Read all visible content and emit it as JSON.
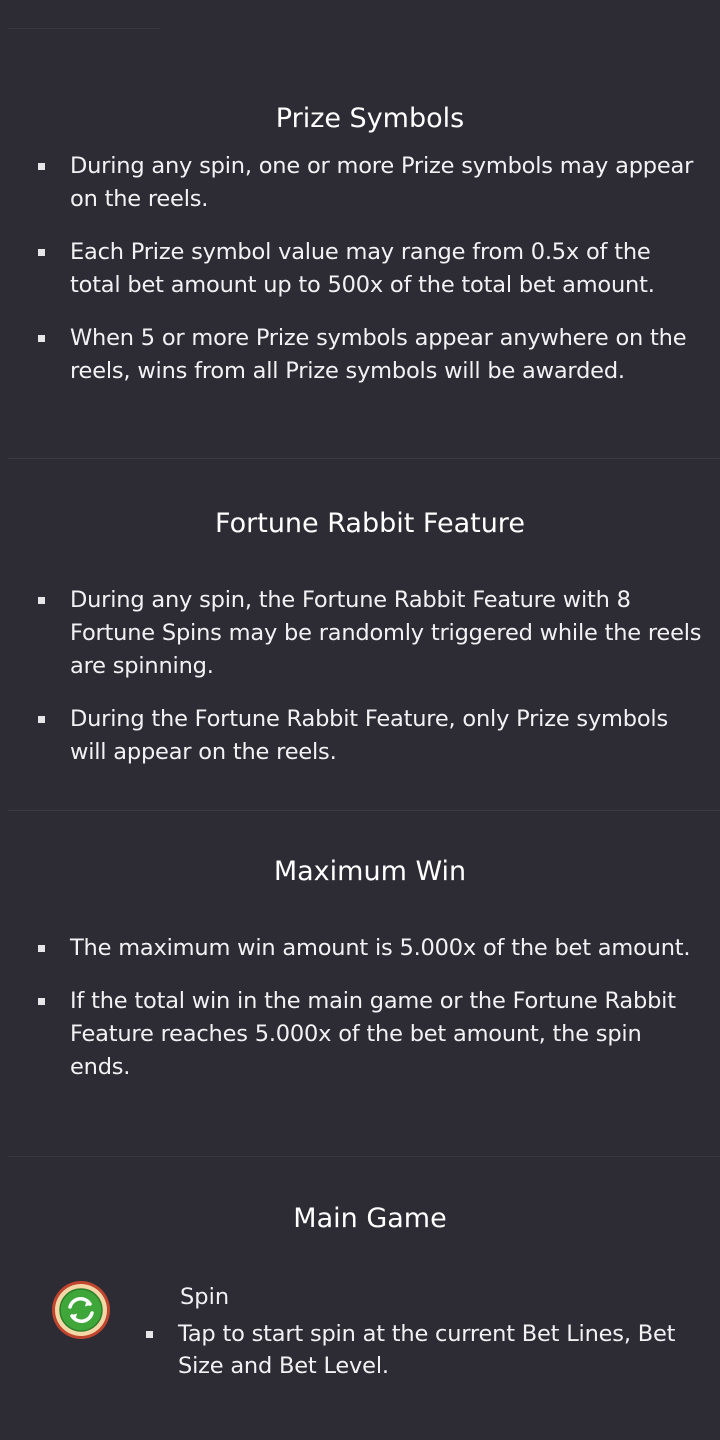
{
  "sections": [
    {
      "title": "Prize Symbols",
      "bullets": [
        "During any spin, one or more Prize symbols may appear on the reels.",
        "Each Prize symbol value may range from 0.5x of the total bet amount up to 500x of the total bet amount.",
        "When 5 or more Prize symbols appear anywhere on the reels, wins from all Prize symbols will be awarded."
      ]
    },
    {
      "title": "Fortune Rabbit Feature",
      "bullets": [
        "During any spin, the Fortune Rabbit Feature with 8 Fortune Spins may be randomly triggered while the reels are spinning.",
        "During the Fortune Rabbit Feature, only Prize symbols will appear on the reels."
      ]
    },
    {
      "title": "Maximum Win",
      "bullets": [
        "The maximum win amount is 5.000x of the bet amount.",
        "If the total win in the main game or the Fortune Rabbit Feature reaches 5.000x of the bet amount, the spin ends."
      ]
    },
    {
      "title": "Main Game",
      "bullets": []
    }
  ],
  "main_game": {
    "spin_label": "Spin",
    "spin_description": "Tap to start spin at the current Bet Lines, Bet Size and Bet Level.",
    "spin_icon": "spin-button-icon"
  },
  "colors": {
    "background": "#2d2c35",
    "text": "#ffffff",
    "divider": "#3a3942",
    "icon_green": "#3fa63a",
    "icon_ring": "#f3d7a7",
    "icon_rim": "#c0452f"
  }
}
